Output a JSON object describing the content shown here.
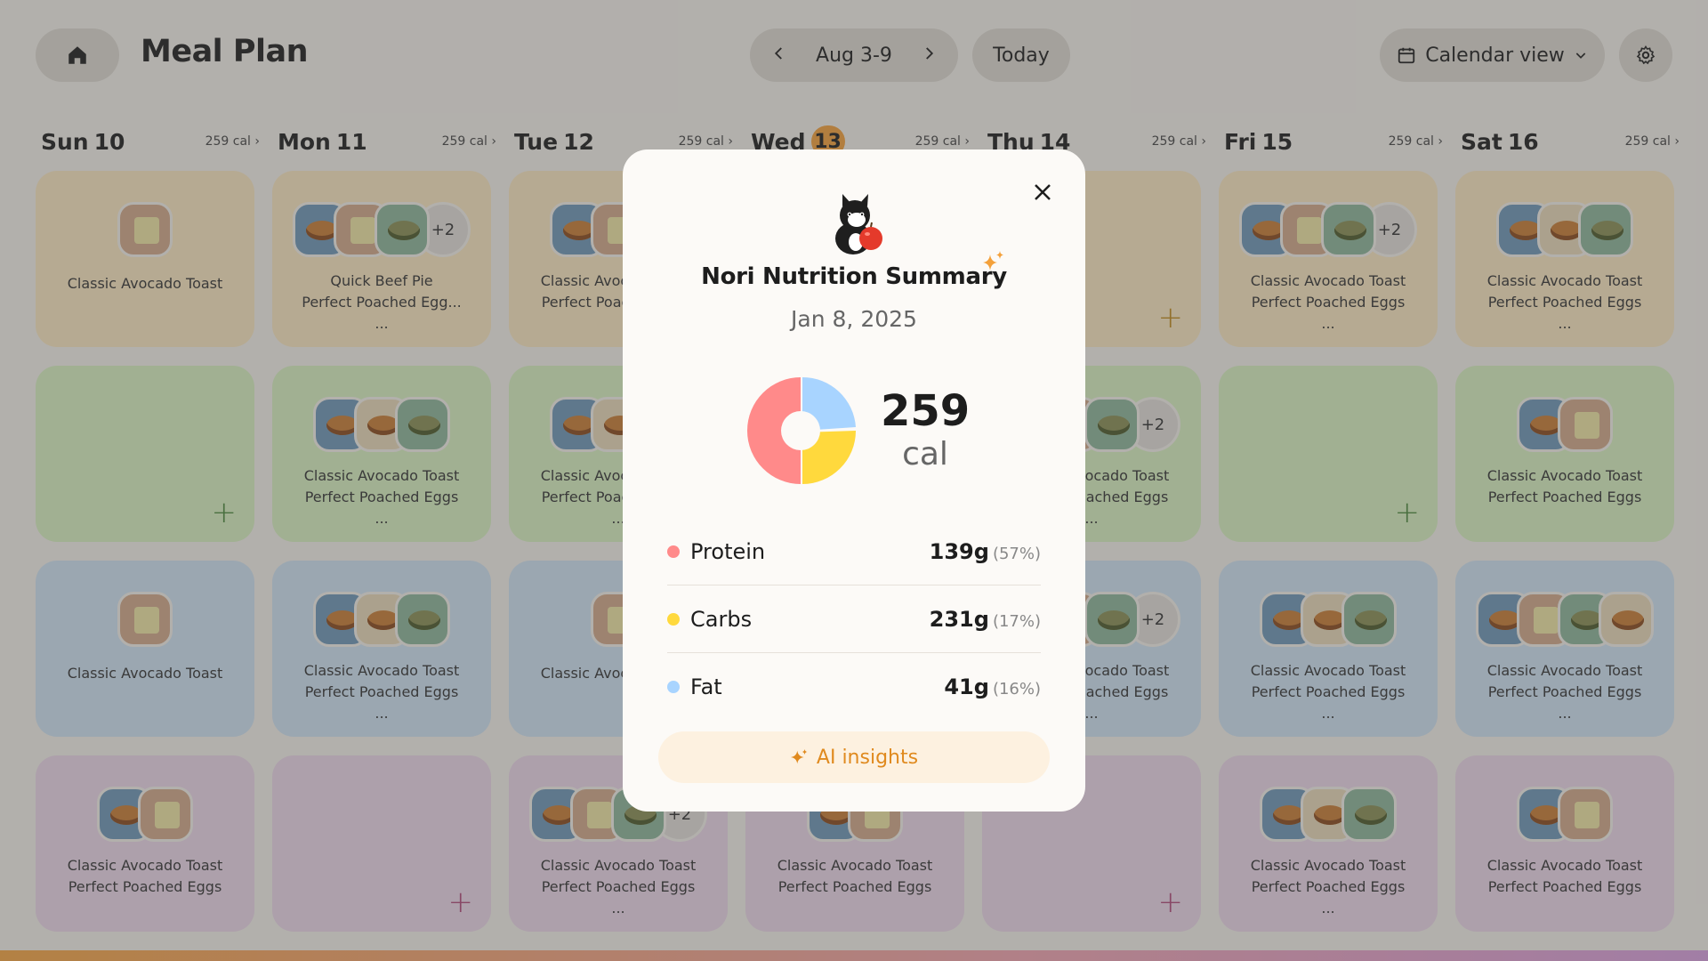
{
  "header": {
    "title": "Meal Plan",
    "week_label": "Aug 3-9",
    "today_label": "Today",
    "view_label": "Calendar view"
  },
  "days": [
    {
      "name": "Sun",
      "num": "10",
      "cal": "259 cal"
    },
    {
      "name": "Mon",
      "num": "11",
      "cal": "259 cal"
    },
    {
      "name": "Tue",
      "num": "12",
      "cal": "259 cal"
    },
    {
      "name": "Wed",
      "num": "13",
      "cal": "259 cal"
    },
    {
      "name": "Thu",
      "num": "14",
      "cal": "259 cal"
    },
    {
      "name": "Fri",
      "num": "15",
      "cal": "259 cal"
    },
    {
      "name": "Sat",
      "num": "16",
      "cal": "259 cal"
    }
  ],
  "today_index": 3,
  "grid": [
    [
      {
        "plates": [
          "tan"
        ],
        "more": "",
        "lines": [
          "Classic Avocado Toast"
        ]
      },
      {
        "plates": [
          "blue",
          "tan",
          "green"
        ],
        "more": "+2",
        "lines": [
          "Quick Beef Pie",
          "Perfect Poached Egg...",
          "..."
        ]
      },
      {
        "plates": [
          "blue",
          "tan",
          "green"
        ],
        "more": "",
        "lines": [
          "Classic Avocado Toast",
          "Perfect Poached Eggs"
        ]
      },
      {
        "plates": [],
        "more": "",
        "lines": []
      },
      {
        "plates": [],
        "more": "",
        "lines": [],
        "add": true
      },
      {
        "plates": [
          "blue",
          "tan",
          "green"
        ],
        "more": "+2",
        "lines": [
          "Classic Avocado Toast",
          "Perfect Poached Eggs",
          "..."
        ]
      },
      {
        "plates": [
          "blue",
          "cream",
          "green"
        ],
        "more": "",
        "lines": [
          "Classic Avocado Toast",
          "Perfect Poached Eggs",
          "..."
        ]
      }
    ],
    [
      {
        "plates": [],
        "more": "",
        "lines": [],
        "add": true
      },
      {
        "plates": [
          "blue",
          "cream",
          "green"
        ],
        "more": "",
        "lines": [
          "Classic Avocado Toast",
          "Perfect Poached Eggs",
          "..."
        ]
      },
      {
        "plates": [
          "blue",
          "cream",
          "green"
        ],
        "more": "",
        "lines": [
          "Classic Avocado Toast",
          "Perfect Poached Eggs",
          "..."
        ]
      },
      {
        "plates": [],
        "more": "",
        "lines": []
      },
      {
        "plates": [
          "blue",
          "tan",
          "green"
        ],
        "more": "+2",
        "lines": [
          "Classic Avocado Toast",
          "Perfect Poached Eggs",
          "..."
        ]
      },
      {
        "plates": [],
        "more": "",
        "lines": [],
        "add": true
      },
      {
        "plates": [
          "blue",
          "tan"
        ],
        "more": "",
        "lines": [
          "Classic Avocado Toast",
          "Perfect Poached Eggs"
        ]
      }
    ],
    [
      {
        "plates": [
          "tan"
        ],
        "more": "",
        "lines": [
          "Classic Avocado Toast"
        ]
      },
      {
        "plates": [
          "blue",
          "cream",
          "green"
        ],
        "more": "",
        "lines": [
          "Classic Avocado Toast",
          "Perfect Poached Eggs",
          "..."
        ]
      },
      {
        "plates": [
          "tan"
        ],
        "more": "",
        "lines": [
          "Classic Avocado Toast"
        ]
      },
      {
        "plates": [],
        "more": "",
        "lines": []
      },
      {
        "plates": [
          "blue",
          "tan",
          "green"
        ],
        "more": "+2",
        "lines": [
          "Classic Avocado Toast",
          "Perfect Poached Eggs",
          "..."
        ]
      },
      {
        "plates": [
          "blue",
          "cream",
          "green"
        ],
        "more": "",
        "lines": [
          "Classic Avocado Toast",
          "Perfect Poached Eggs",
          "..."
        ]
      },
      {
        "plates": [
          "blue",
          "tan",
          "green",
          "cream"
        ],
        "more": "",
        "lines": [
          "Classic Avocado Toast",
          "Perfect Poached Eggs",
          "..."
        ]
      }
    ],
    [
      {
        "plates": [
          "blue",
          "tan"
        ],
        "more": "",
        "lines": [
          "Classic Avocado Toast",
          "Perfect Poached Eggs"
        ]
      },
      {
        "plates": [],
        "more": "",
        "lines": [],
        "add": true
      },
      {
        "plates": [
          "blue",
          "tan",
          "green"
        ],
        "more": "+2",
        "lines": [
          "Classic Avocado Toast",
          "Perfect Poached Eggs",
          "..."
        ]
      },
      {
        "plates": [
          "blue",
          "tan"
        ],
        "more": "",
        "lines": [
          "Classic Avocado Toast",
          "Perfect Poached Eggs"
        ]
      },
      {
        "plates": [],
        "more": "",
        "lines": [],
        "add": true
      },
      {
        "plates": [
          "blue",
          "cream",
          "green"
        ],
        "more": "",
        "lines": [
          "Classic Avocado Toast",
          "Perfect Poached Eggs",
          "..."
        ]
      },
      {
        "plates": [
          "blue",
          "tan"
        ],
        "more": "",
        "lines": [
          "Classic Avocado Toast",
          "Perfect Poached Eggs"
        ]
      }
    ]
  ],
  "modal": {
    "title": "Nori Nutrition Summary",
    "date": "Jan 8, 2025",
    "calories": "259",
    "cal_unit": "cal",
    "macros": [
      {
        "label": "Protein",
        "grams": "139g",
        "pct": "(57%)",
        "color": "#ff8a8a"
      },
      {
        "label": "Carbs",
        "grams": "231g",
        "pct": "(17%)",
        "color": "#ffd93d"
      },
      {
        "label": "Fat",
        "grams": "41g",
        "pct": "(16%)",
        "color": "#a8d4ff"
      }
    ],
    "ai_label": "AI insights"
  },
  "colors": {
    "accent_orange": "#e08a1e",
    "today_badge": "#f4a13b",
    "row_colors": [
      "#fbe7c0",
      "#d9f0c1",
      "#cfe2f3",
      "#ecd7e9"
    ]
  }
}
